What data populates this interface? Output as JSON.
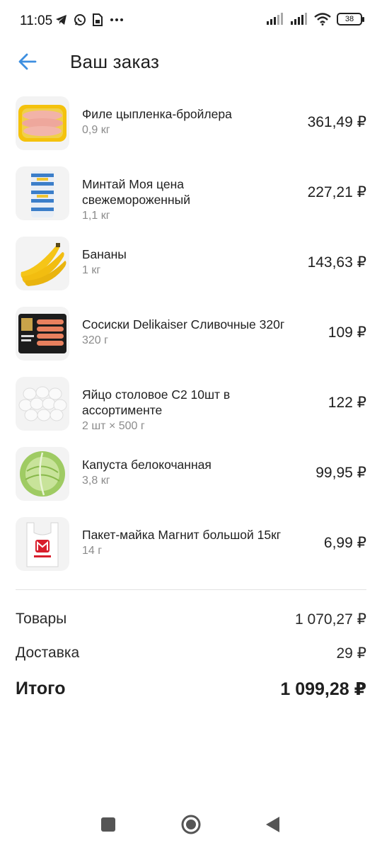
{
  "status": {
    "time": "11:05",
    "battery": "38",
    "icons": [
      "telegram-icon",
      "whatsapp-icon",
      "sim-card-icon",
      "more-icon",
      "signal-icon",
      "signal-icon",
      "wifi-icon",
      "battery-icon"
    ]
  },
  "header": {
    "title": "Ваш заказ",
    "back_icon": "arrow-left-icon"
  },
  "items": [
    {
      "name": "Филе цыпленка-бройлера",
      "qty": "0,9 кг",
      "price": "361,49 ₽",
      "image": "chicken-fillet-image"
    },
    {
      "name": "Минтай Моя цена свежемороженный",
      "qty": "1,1 кг",
      "price": "227,21 ₽",
      "image": "fish-pack-image"
    },
    {
      "name": "Бананы",
      "qty": "1 кг",
      "price": "143,63 ₽",
      "image": "bananas-image"
    },
    {
      "name": "Сосиски Delikaiser Сливочные 320г",
      "qty": "320 г",
      "price": "109 ₽",
      "image": "sausages-pack-image"
    },
    {
      "name": "Яйцо столовое С2 10шт в ассортименте",
      "qty": "2 шт × 500 г",
      "price": "122 ₽",
      "image": "eggs-image"
    },
    {
      "name": "Капуста белокочанная",
      "qty": "3,8 кг",
      "price": "99,95 ₽",
      "image": "cabbage-image"
    },
    {
      "name": "Пакет-майка Магнит большой 15кг",
      "qty": "14 г",
      "price": "6,99 ₽",
      "image": "plastic-bag-image"
    }
  ],
  "summary": {
    "goods_label": "Товары",
    "goods_value": "1 070,27 ₽",
    "delivery_label": "Доставка",
    "delivery_value": "29 ₽",
    "total_label": "Итого",
    "total_value": "1 099,28 ₽"
  },
  "colors": {
    "accent": "#3d8fe0",
    "text": "#1f1f1f",
    "muted": "#8b8b8b",
    "divider": "#e2e2e2"
  }
}
